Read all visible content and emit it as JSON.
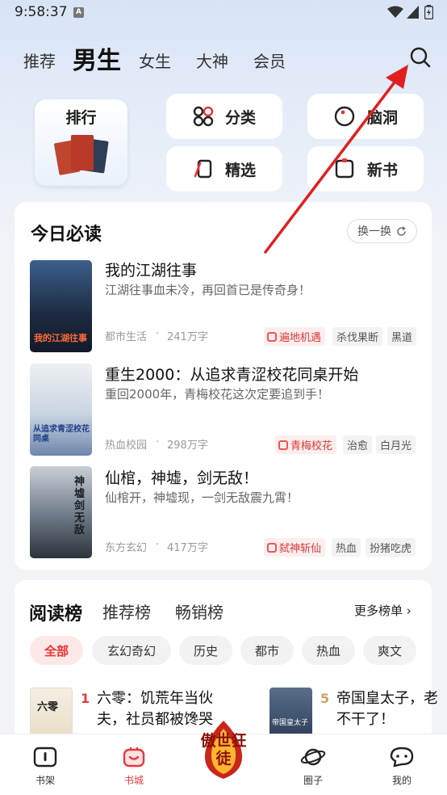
{
  "status": {
    "time": "9:58:37",
    "badge": "A"
  },
  "top_tabs": [
    "推荐",
    "男生",
    "女生",
    "大神",
    "会员"
  ],
  "active_top_tab": "男生",
  "quick": {
    "rank": "排行",
    "category": "分类",
    "brain": "脑洞",
    "selected": "精选",
    "new_books": "新书"
  },
  "today": {
    "title": "今日必读",
    "refresh": "换一换",
    "books": [
      {
        "title": "我的江湖往事",
        "desc": "江湖往事血未冷，再回首已是传奇身！",
        "genre": "都市生活",
        "words": "241万字",
        "hot_tag": "遍地机遇",
        "tags": [
          "杀伐果断",
          "黑道"
        ],
        "cover_text": "我的江湖往事"
      },
      {
        "title": "重生2000：从追求青涩校花同桌开始",
        "desc": "重回2000年，青梅校花这次定要追到手！",
        "genre": "热血校园",
        "words": "298万字",
        "hot_tag": "青梅校花",
        "tags": [
          "治愈",
          "白月光"
        ],
        "cover_text": "从追求青涩校花同桌"
      },
      {
        "title": "仙棺，神墟，剑无敌！",
        "desc": "仙棺开，神墟现，一剑无敌震九霄！",
        "genre": "东方玄幻",
        "words": "417万字",
        "hot_tag": "弑神斩仙",
        "tags": [
          "热血",
          "扮猪吃虎"
        ],
        "cover_text": "神墟剑无敌"
      }
    ]
  },
  "ranking": {
    "tabs": [
      "阅读榜",
      "推荐榜",
      "畅销榜"
    ],
    "more": "更多榜单",
    "chips": [
      "全部",
      "玄幻奇幻",
      "历史",
      "都市",
      "热血",
      "爽文"
    ],
    "items": [
      {
        "rank": "1",
        "title_line1": "六零：饥荒年当伙",
        "title_line2": "夫，社员都被馋哭",
        "cover_text": "六零"
      },
      {
        "rank": "5",
        "title_line1": "帝国皇太子，老",
        "title_line2": "不干了！",
        "cover_text": "帝国皇太子"
      }
    ]
  },
  "bottom_nav": [
    "书架",
    "书城",
    "傲世狂徒",
    "圈子",
    "我的"
  ],
  "colors": {
    "accent": "#e8383d",
    "arrow": "#e02020",
    "bg": "#f2f4f7"
  }
}
